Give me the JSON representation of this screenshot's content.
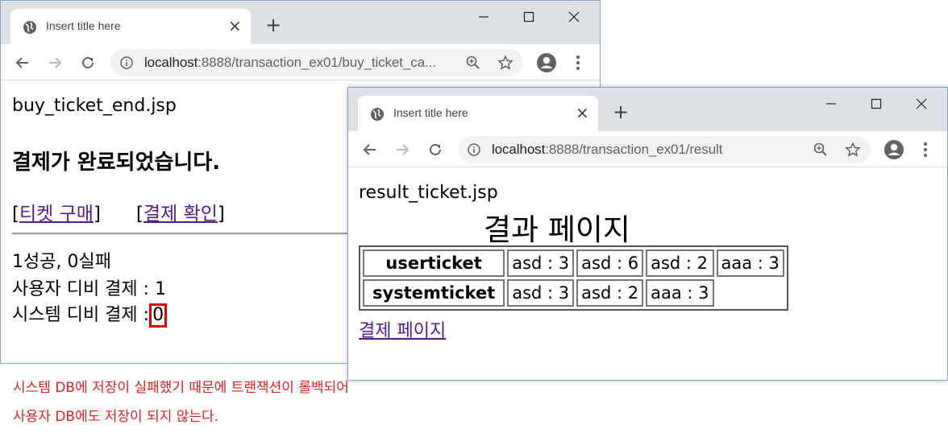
{
  "window1": {
    "tab_title": "Insert title here",
    "url_host": "localhost",
    "url_path": ":8888/transaction_ex01/buy_ticket_ca...",
    "page": {
      "filename": "buy_ticket_end.jsp",
      "heading": "결제가 완료되었습니다.",
      "link_buy": "티켓 구매",
      "link_check": "결제 확인",
      "bracket_open": "[",
      "bracket_close": "]",
      "result_line1": "1성공, 0실패",
      "result_line2": "사용자 디비 결제 : 1",
      "result_line3_label": "시스템 디비 결제 :",
      "result_line3_value": "0"
    }
  },
  "window2": {
    "tab_title": "Insert title here",
    "url_host": "localhost",
    "url_path": ":8888/transaction_ex01/result",
    "page": {
      "filename": "result_ticket.jsp",
      "heading": "결과 페이지",
      "table": {
        "rows": [
          {
            "header": "userticket",
            "cells": [
              "asd : 3",
              "asd : 6",
              "asd : 2",
              "aaa : 3"
            ]
          },
          {
            "header": "systemticket",
            "cells": [
              "asd : 3",
              "asd : 2",
              "aaa : 3"
            ]
          }
        ]
      },
      "link_payment": "결제 페이지"
    }
  },
  "caption": {
    "line1": "시스템 DB에 저장이 실패했기 때문에 트랜잭션이 롤백되어",
    "line2": "사용자 DB에도 저장이 되지 않는다."
  },
  "colors": {
    "titlebar": "#dee1e6",
    "link": "#551a8b",
    "highlight_box": "#e00000",
    "caption": "#e02020"
  },
  "icons": [
    "globe-icon",
    "close-icon",
    "plus-icon",
    "minimize-icon",
    "maximize-icon",
    "window-close-icon",
    "back-icon",
    "forward-icon",
    "reload-icon",
    "info-icon",
    "zoom-icon",
    "star-icon",
    "profile-icon",
    "menu-icon"
  ]
}
